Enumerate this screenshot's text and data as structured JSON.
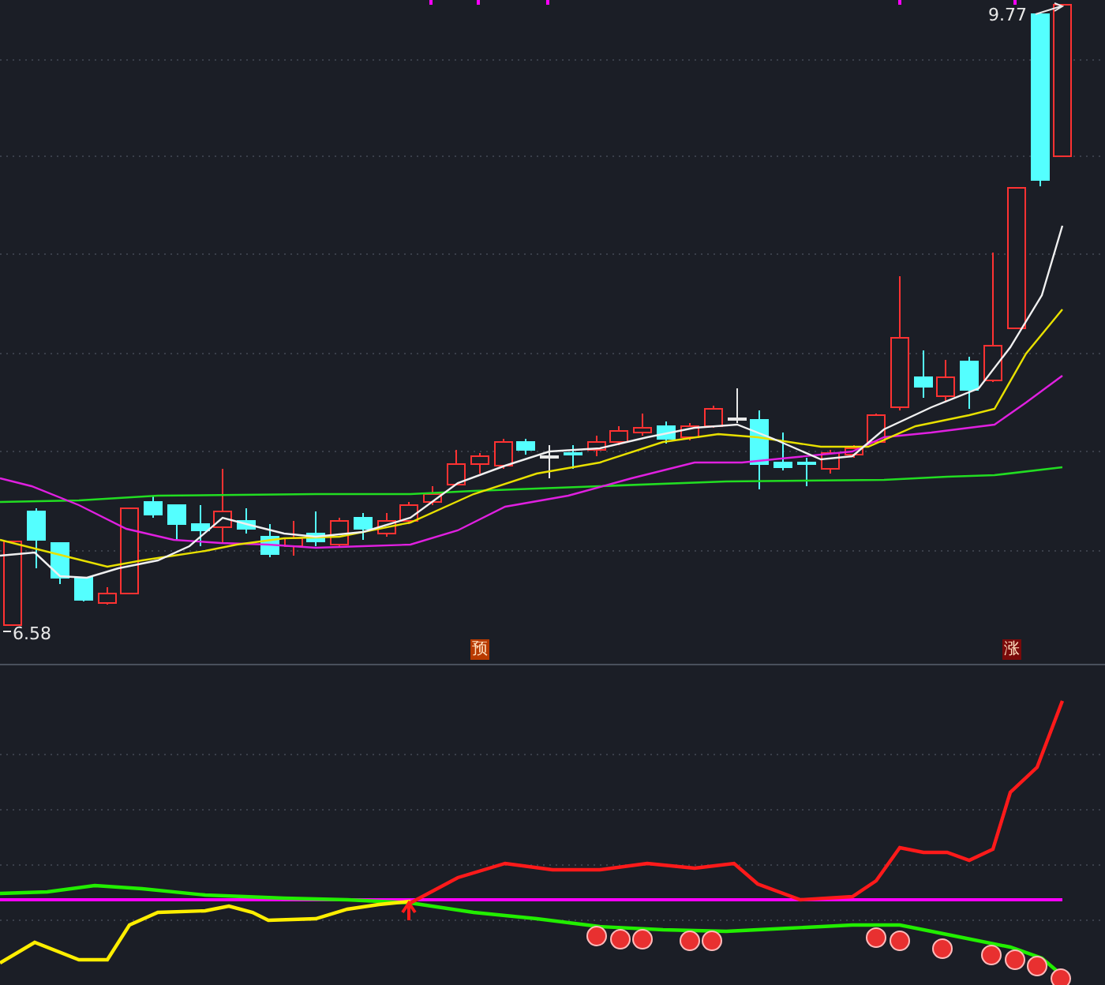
{
  "price_panel": {
    "high_label": "9.77",
    "low_label": "6.58",
    "markers": [
      {
        "text": "预",
        "color": "#b83a00"
      },
      {
        "text": "涨",
        "color": "#7a0a0a"
      }
    ]
  }
}
